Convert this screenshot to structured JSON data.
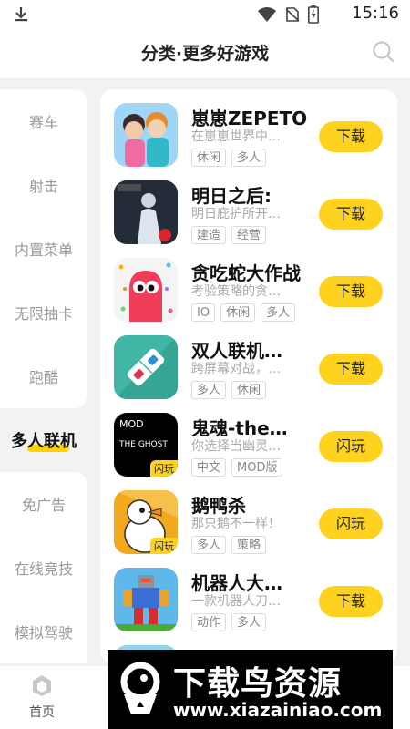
{
  "status_bar": {
    "time": "15:16"
  },
  "header": {
    "title": "分类·更多好游戏"
  },
  "categories": [
    {
      "label": "赛车"
    },
    {
      "label": "射击"
    },
    {
      "label": "内置菜单"
    },
    {
      "label": "无限抽卡"
    },
    {
      "label": "跑酷"
    },
    {
      "label": "多人联机",
      "active": true
    },
    {
      "label": "免广告"
    },
    {
      "label": "在线竞技"
    },
    {
      "label": "模拟驾驶"
    }
  ],
  "games": [
    {
      "name": "崽崽ZEPETO",
      "desc": "在崽崽世界中…",
      "tags": [
        "休闲",
        "多人"
      ],
      "button": "下载"
    },
    {
      "name": "明日之后:",
      "desc": "明日庇护所开…",
      "tags": [
        "建造",
        "经营"
      ],
      "button": "下载"
    },
    {
      "name": "贪吃蛇大作战",
      "desc": "考验策略的贪…",
      "tags": [
        "IO",
        "休闲",
        "多人"
      ],
      "button": "下载"
    },
    {
      "name": "双人联机…",
      "desc": "跨屏幕对战，…",
      "tags": [
        "多人",
        "休闲"
      ],
      "button": "下载"
    },
    {
      "name": "鬼魂-the…",
      "desc": "你选择当幽灵…",
      "tags": [
        "中文",
        "MOD版"
      ],
      "button": "闪玩",
      "icon_text_1": "MOD",
      "icon_text_2": "THE GHOST",
      "badge": "闪玩"
    },
    {
      "name": "鹅鸭杀",
      "desc": "那只鹅不一样！",
      "tags": [
        "多人",
        "策略"
      ],
      "button": "闪玩",
      "badge": "闪玩"
    },
    {
      "name": "机器人大…",
      "desc": "一款机器人刀…",
      "tags": [
        "动作",
        "多人"
      ],
      "button": "下载"
    }
  ],
  "bottom_nav": {
    "home_label": "首页"
  },
  "watermark": {
    "title": "下载鸟资源",
    "url": "www.xiazainiao.com"
  },
  "colors": {
    "accent": "#ffd21f",
    "background": "#f2f2f2"
  }
}
